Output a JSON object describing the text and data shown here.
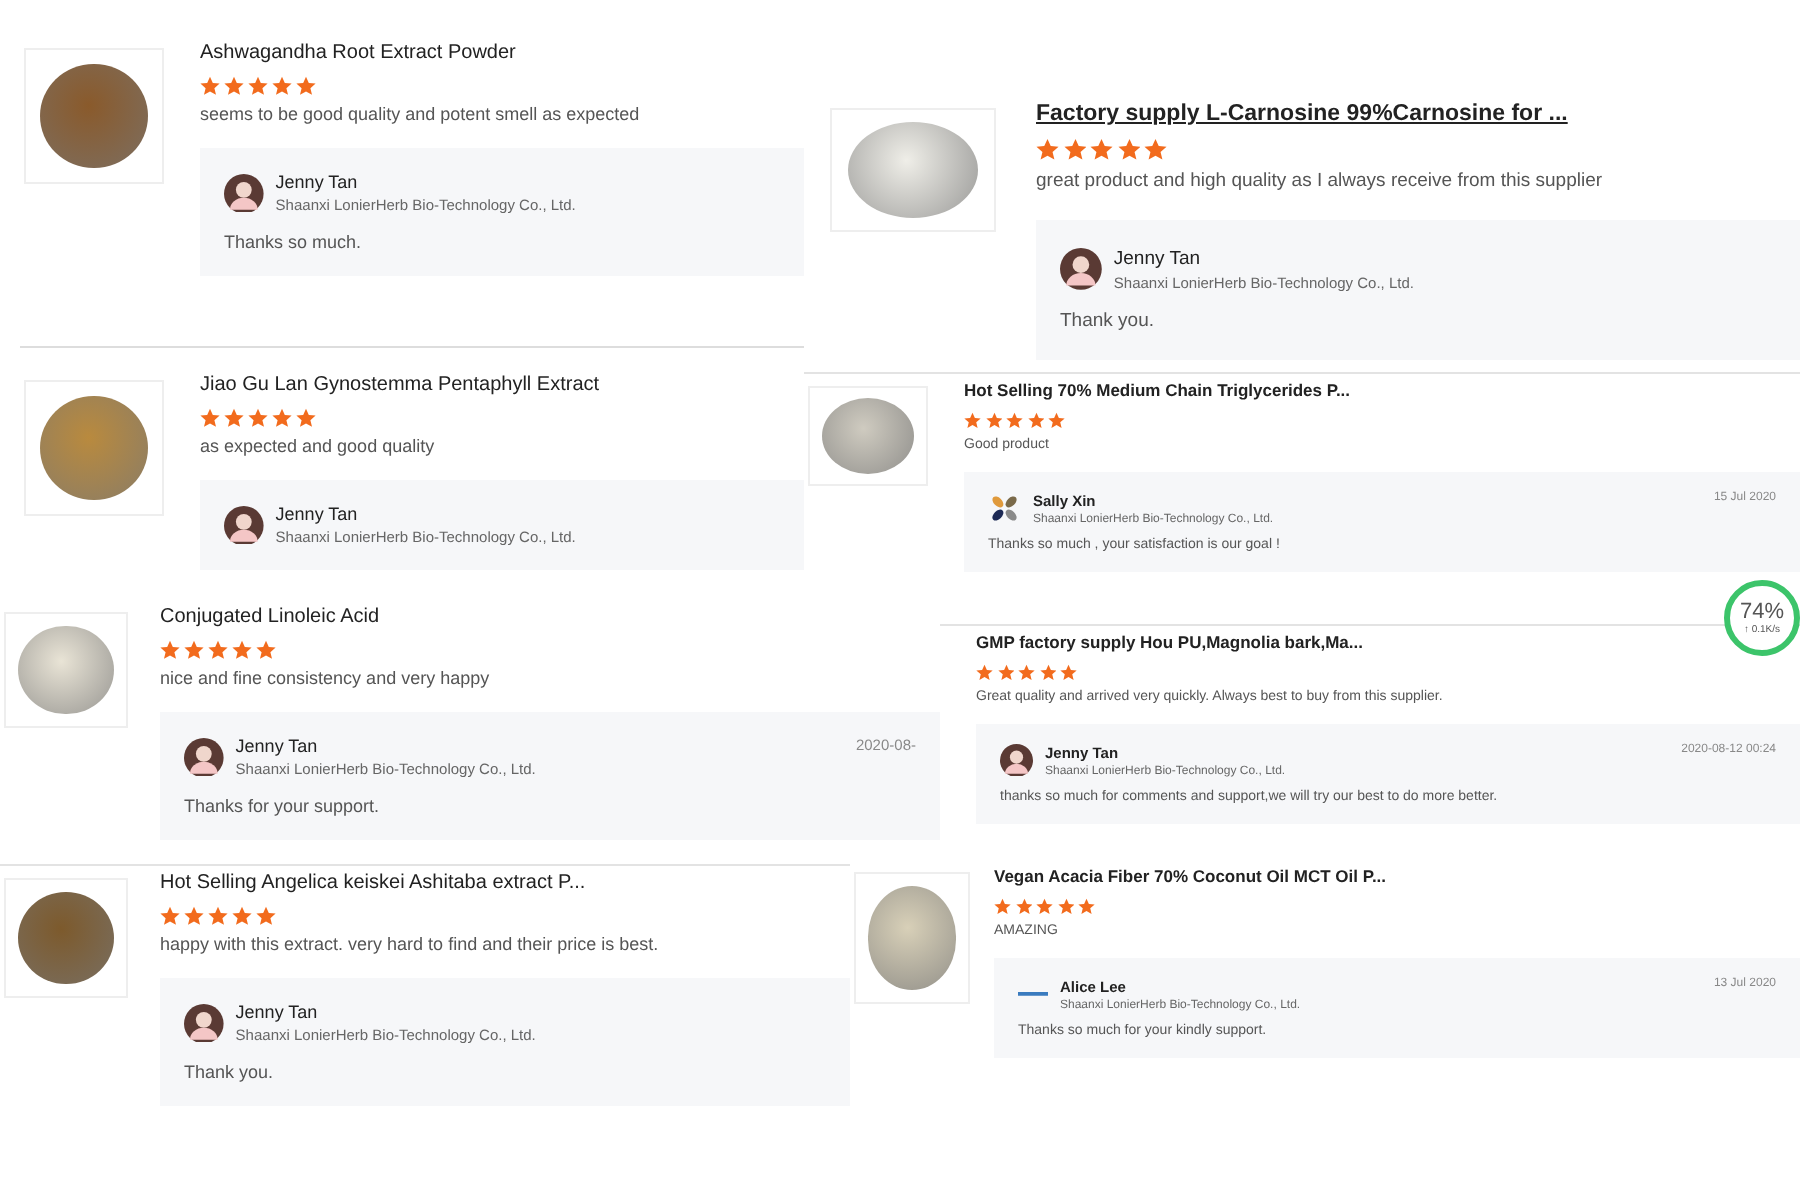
{
  "reviews": [
    {
      "title": "Ashwagandha Root Extract Powder",
      "underlined": false,
      "photo": true,
      "stars": 5,
      "comment": "seems to be good quality and potent smell as expected",
      "reply": {
        "kind": "portrait",
        "name": "Jenny Tan",
        "company": "Shaanxi LonierHerb Bio-Technology Co., Ltd.",
        "text": "Thanks so much."
      }
    },
    {
      "title": "Factory supply L-Carnosine 99%Carnosine for ...",
      "underlined": true,
      "photo": true,
      "stars": 5,
      "comment": "great product and high quality as I always receive from this supplier",
      "reply": {
        "kind": "portrait",
        "name": "Jenny Tan",
        "company": "Shaanxi LonierHerb Bio-Technology Co., Ltd.",
        "text": "Thank you."
      }
    },
    {
      "title": "Jiao Gu Lan Gynostemma Pentaphyll Extract",
      "underlined": false,
      "photo": true,
      "stars": 5,
      "comment": "as expected and good quality",
      "reply": {
        "kind": "portrait",
        "name": "Jenny Tan",
        "company": "Shaanxi LonierHerb Bio-Technology Co., Ltd."
      }
    },
    {
      "title": "Hot Selling 70% Medium Chain Triglycerides P...",
      "underlined": false,
      "photo": true,
      "stars": 5,
      "comment": "Good product",
      "reply": {
        "kind": "pinwheel",
        "name": "Sally Xin",
        "company": "Shaanxi LonierHerb Bio-Technology Co., Ltd.",
        "date": "15 Jul 2020",
        "text": "Thanks so much ,  your satisfaction is our goal !"
      }
    },
    {
      "title": "Conjugated Linoleic Acid",
      "underlined": false,
      "photo": true,
      "stars": 5,
      "comment": "nice and fine consistency and very happy",
      "reply": {
        "kind": "portrait",
        "name": "Jenny Tan",
        "company": "Shaanxi LonierHerb Bio-Technology Co., Ltd.",
        "date": "2020-08-",
        "text": "Thanks for your support."
      }
    },
    {
      "title": "GMP factory supply Hou PU,Magnolia bark,Ma...",
      "underlined": false,
      "photo": false,
      "stars": 5,
      "comment": "Great quality and arrived very quickly.  Always best to buy from this supplier.",
      "reply": {
        "kind": "portrait",
        "name": "Jenny Tan",
        "company": "Shaanxi LonierHerb Bio-Technology Co., Ltd.",
        "date": "2020-08-12 00:24",
        "text": "thanks so much for comments and support,we will try our best to do more better."
      }
    },
    {
      "title": "Hot Selling Angelica keiskei Ashitaba extract P...",
      "underlined": false,
      "photo": true,
      "stars": 5,
      "comment": "happy with this extract.  very hard to find and their price is best.",
      "reply": {
        "kind": "portrait",
        "name": "Jenny Tan",
        "company": "Shaanxi LonierHerb Bio-Technology Co., Ltd.",
        "text": "Thank you."
      }
    },
    {
      "title": "Vegan Acacia Fiber 70% Coconut Oil MCT Oil P...",
      "underlined": false,
      "photo": true,
      "stars": 5,
      "comment": "AMAZING",
      "reply": {
        "kind": "logo",
        "name": "Alice Lee",
        "company": "Shaanxi LonierHerb Bio-Technology Co., Ltd.",
        "date": "13 Jul 2020",
        "text": "Thanks so much for your kindly support."
      }
    }
  ],
  "speed_widget": {
    "percent": "74%",
    "speed": "↑ 0.1K/s"
  }
}
